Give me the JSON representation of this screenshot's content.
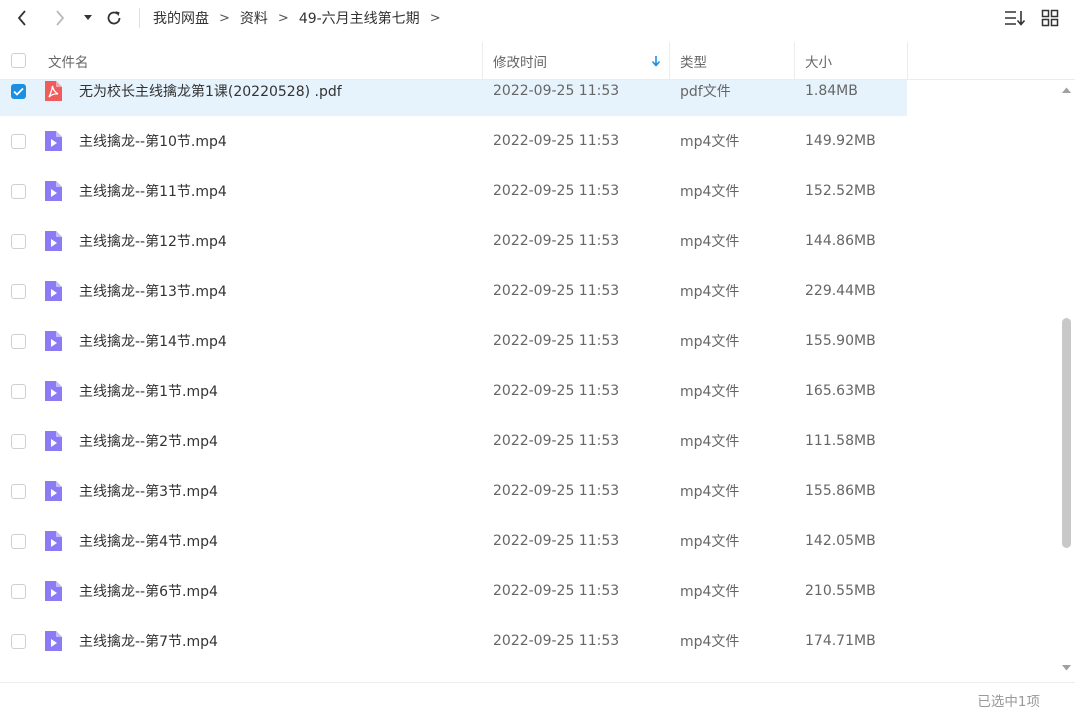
{
  "toolbar": {
    "back_icon": "chevron-left-icon",
    "forward_icon": "chevron-right-icon",
    "history_icon": "caret-down-icon",
    "refresh_icon": "refresh-icon",
    "sort_icon": "sort-list-icon",
    "grid_icon": "grid-view-icon"
  },
  "breadcrumb": {
    "items": [
      "我的网盘",
      "资料",
      "49-六月主线第七期"
    ],
    "separator": ">"
  },
  "columns": {
    "name": "文件名",
    "modified": "修改时间",
    "type": "类型",
    "size": "大小"
  },
  "files": [
    {
      "name": "无为校长主线擒龙第1课(20220528) .pdf",
      "modified": "2022-09-25 11:53",
      "type": "pdf文件",
      "size": "1.84MB",
      "kind": "pdf",
      "selected": true
    },
    {
      "name": "主线擒龙--第10节.mp4",
      "modified": "2022-09-25 11:53",
      "type": "mp4文件",
      "size": "149.92MB",
      "kind": "video",
      "selected": false
    },
    {
      "name": "主线擒龙--第11节.mp4",
      "modified": "2022-09-25 11:53",
      "type": "mp4文件",
      "size": "152.52MB",
      "kind": "video",
      "selected": false
    },
    {
      "name": "主线擒龙--第12节.mp4",
      "modified": "2022-09-25 11:53",
      "type": "mp4文件",
      "size": "144.86MB",
      "kind": "video",
      "selected": false
    },
    {
      "name": "主线擒龙--第13节.mp4",
      "modified": "2022-09-25 11:53",
      "type": "mp4文件",
      "size": "229.44MB",
      "kind": "video",
      "selected": false
    },
    {
      "name": "主线擒龙--第14节.mp4",
      "modified": "2022-09-25 11:53",
      "type": "mp4文件",
      "size": "155.90MB",
      "kind": "video",
      "selected": false
    },
    {
      "name": "主线擒龙--第1节.mp4",
      "modified": "2022-09-25 11:53",
      "type": "mp4文件",
      "size": "165.63MB",
      "kind": "video",
      "selected": false
    },
    {
      "name": "主线擒龙--第2节.mp4",
      "modified": "2022-09-25 11:53",
      "type": "mp4文件",
      "size": "111.58MB",
      "kind": "video",
      "selected": false
    },
    {
      "name": "主线擒龙--第3节.mp4",
      "modified": "2022-09-25 11:53",
      "type": "mp4文件",
      "size": "155.86MB",
      "kind": "video",
      "selected": false
    },
    {
      "name": "主线擒龙--第4节.mp4",
      "modified": "2022-09-25 11:53",
      "type": "mp4文件",
      "size": "142.05MB",
      "kind": "video",
      "selected": false
    },
    {
      "name": "主线擒龙--第6节.mp4",
      "modified": "2022-09-25 11:53",
      "type": "mp4文件",
      "size": "210.55MB",
      "kind": "video",
      "selected": false
    },
    {
      "name": "主线擒龙--第7节.mp4",
      "modified": "2022-09-25 11:53",
      "type": "mp4文件",
      "size": "174.71MB",
      "kind": "video",
      "selected": false
    }
  ],
  "status": {
    "selection_text": "已选中1项"
  },
  "colors": {
    "accent": "#1d8fe1",
    "selected_row": "#e6f3fc",
    "pdf_icon": "#f05c5c",
    "video_icon": "#8b7cf6"
  }
}
